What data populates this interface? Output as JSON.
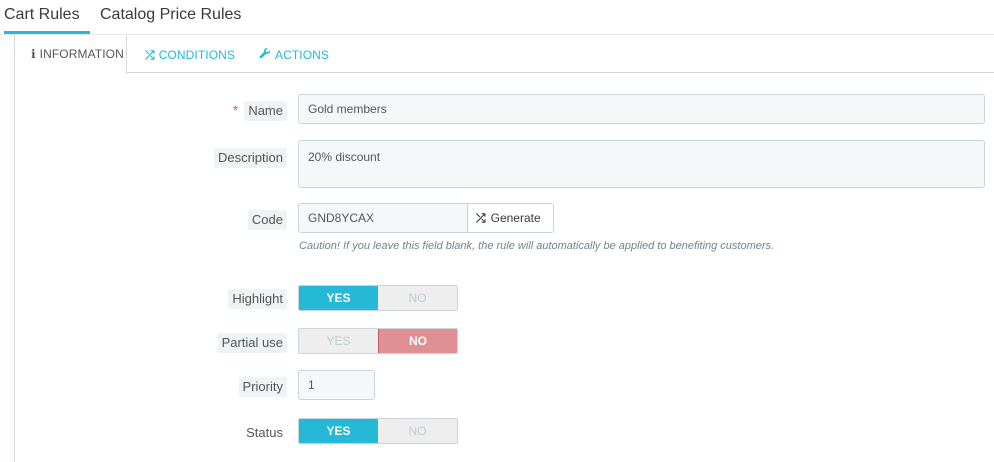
{
  "top_tabs": [
    {
      "label": "Cart Rules",
      "active": true
    },
    {
      "label": "Catalog Price Rules",
      "active": false
    }
  ],
  "inner_tabs": [
    {
      "label": "INFORMATION",
      "icon": "info-icon",
      "active": true
    },
    {
      "label": "CONDITIONS",
      "icon": "shuffle-icon",
      "active": false
    },
    {
      "label": "ACTIONS",
      "icon": "wrench-icon",
      "active": false
    }
  ],
  "form": {
    "name": {
      "label": "Name",
      "required_mark": "*",
      "value": "Gold members"
    },
    "description": {
      "label": "Description",
      "value": "20% discount"
    },
    "code": {
      "label": "Code",
      "value": "GND8YCAX",
      "generate_label": "Generate",
      "hint": "Caution! If you leave this field blank, the rule will automatically be applied to benefiting customers."
    },
    "highlight": {
      "label": "Highlight",
      "yes": "YES",
      "no": "NO",
      "selected": "YES"
    },
    "partial_use": {
      "label": "Partial use",
      "yes": "YES",
      "no": "NO",
      "selected": "NO"
    },
    "priority": {
      "label": "Priority",
      "value": "1"
    },
    "status": {
      "label": "Status",
      "yes": "YES",
      "no": "NO",
      "selected": "YES"
    }
  },
  "colors": {
    "accent": "#25b9d7",
    "no_selected": "#e08f95",
    "required": "#e35b5b"
  }
}
